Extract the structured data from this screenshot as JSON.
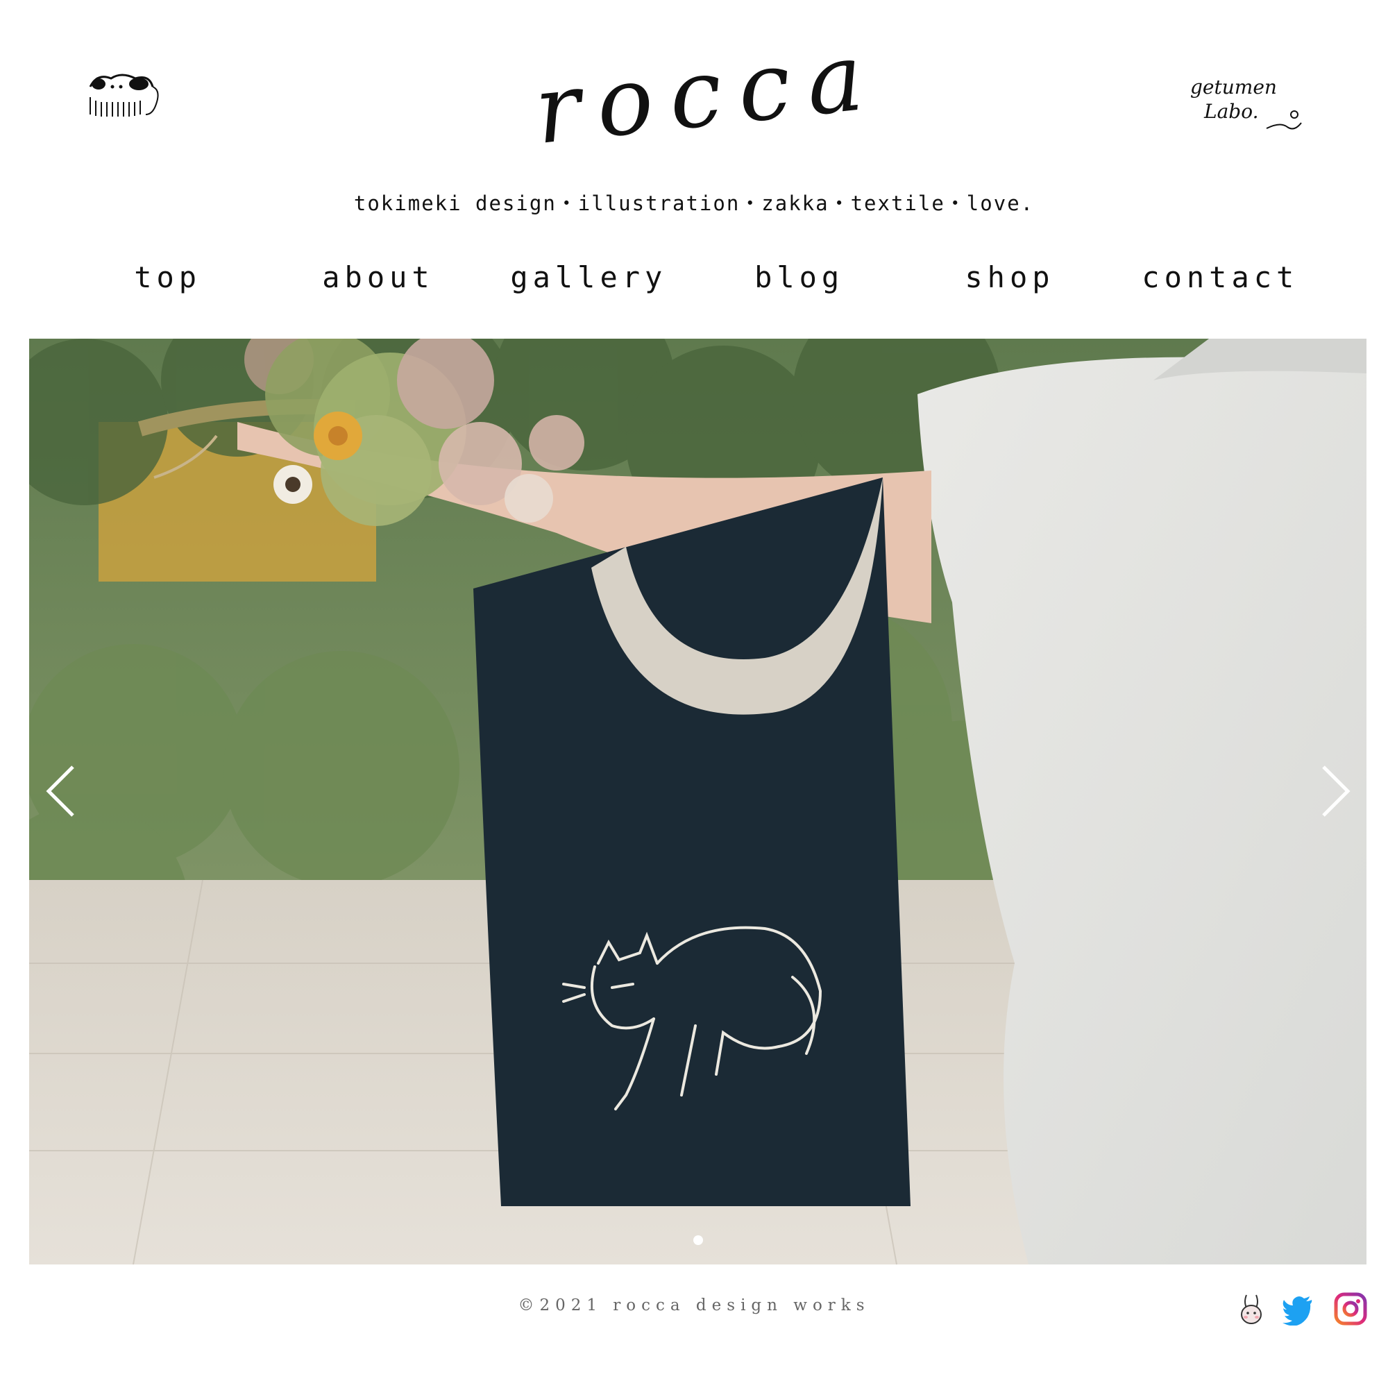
{
  "header": {
    "title": "rocca",
    "tagline": "tokimeki design・illustration・zakka・textile・love.",
    "left_logo_icon": "dog-logo-icon",
    "right_logo_icon": "getumen-labo-logo-icon",
    "right_logo_text_1": "getumen",
    "right_logo_text_2": "Labo."
  },
  "nav": {
    "items": [
      {
        "label": "top"
      },
      {
        "label": "about"
      },
      {
        "label": "gallery"
      },
      {
        "label": "blog"
      },
      {
        "label": "shop"
      },
      {
        "label": "contact"
      }
    ]
  },
  "slider": {
    "image_icon": "hero-photo-tote-bag-cat",
    "prev_icon": "chevron-left-icon",
    "next_icon": "chevron-right-icon",
    "active_index": 0
  },
  "footer": {
    "copyright": "©2021 rocca design works",
    "social": [
      {
        "icon": "rabbit-icon"
      },
      {
        "icon": "twitter-icon",
        "color": "#1DA1F2"
      },
      {
        "icon": "instagram-icon",
        "color": "#E1306C"
      }
    ]
  }
}
